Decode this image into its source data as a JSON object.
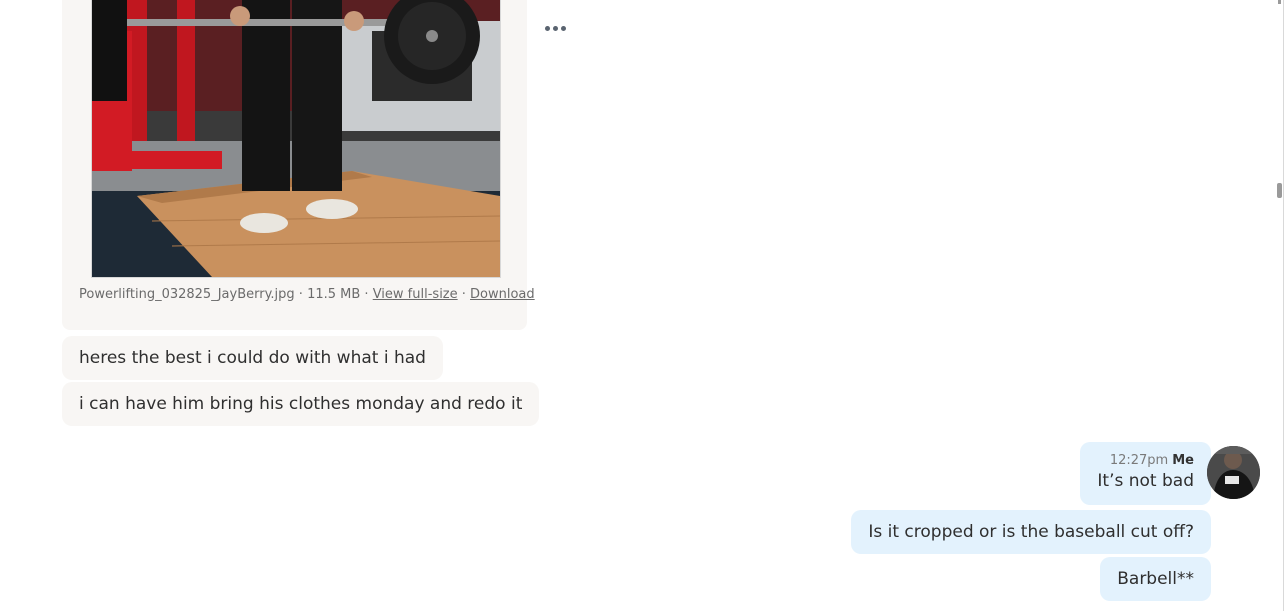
{
  "attachment": {
    "file_name": "Powerlifting_032825_JayBerry.jpg",
    "separator_1": " · ",
    "file_size": "11.5 MB",
    "separator_2": " · ",
    "view_label": "View full-size",
    "separator_3": " · ",
    "download_label": "Download"
  },
  "incoming_messages": [
    {
      "text": "heres the best i could do with what i had"
    },
    {
      "text": "i can have him bring his clothes monday and redo it"
    }
  ],
  "outgoing": {
    "time": "12:27pm",
    "sender": "Me",
    "messages": [
      {
        "text": "It’s not bad"
      },
      {
        "text": "Is it cropped or is the baseball cut off?"
      },
      {
        "text": "Barbell**"
      }
    ]
  },
  "icons": {
    "more": "more-options-icon",
    "avatar": "user-avatar"
  },
  "colors": {
    "incoming_bubble": "#f8f6f4",
    "outgoing_bubble": "#e3f2fd"
  }
}
